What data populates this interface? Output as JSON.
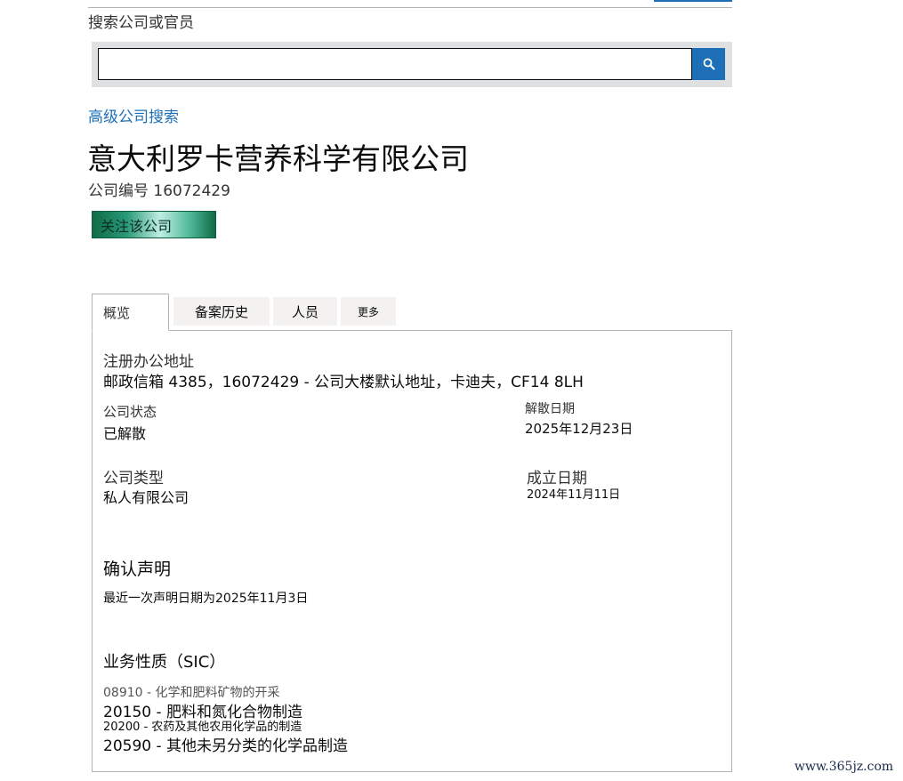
{
  "search": {
    "label": "搜索公司或官员",
    "value": "",
    "placeholder": ""
  },
  "advanced_search_link": "高级公司搜索",
  "company": {
    "name": "意大利罗卡营养科学有限公司",
    "number_label": "公司编号",
    "number": "16072429",
    "follow_label": "关注该公司"
  },
  "tabs": [
    {
      "label": "概览",
      "active": true
    },
    {
      "label": "备案历史",
      "active": false
    },
    {
      "label": "人员",
      "active": false
    },
    {
      "label": "更多",
      "active": false
    }
  ],
  "overview": {
    "registered_office_label": "注册办公地址",
    "registered_office_value": "邮政信箱 4385，16072429 - 公司大楼默认地址，卡迪夫，CF14 8LH",
    "status_label": "公司状态",
    "status_value": "已解散",
    "dissolved_label": "解散日期",
    "dissolved_value": "2025年12月23日",
    "type_label": "公司类型",
    "type_value": "私人有限公司",
    "incorporated_label": "成立日期",
    "incorporated_value": "2024年11月11日",
    "confirmation_heading": "确认声明",
    "confirmation_text": "最近一次声明日期为2025年11月3日",
    "sic_heading": "业务性质（SIC）",
    "sic_items": [
      "08910 - 化学和肥料矿物的开采",
      "20150 - 肥料和氮化合物制造",
      "20200 - 农药及其他农用化学品的制造",
      "20590 - 其他未另分类的化学品制造"
    ]
  },
  "watermark": "www.365jz.com",
  "colors": {
    "link": "#1d70b8",
    "search_button": "#1d70b8",
    "border": "#b1b4b6",
    "follow_button": "#1f8a66"
  }
}
